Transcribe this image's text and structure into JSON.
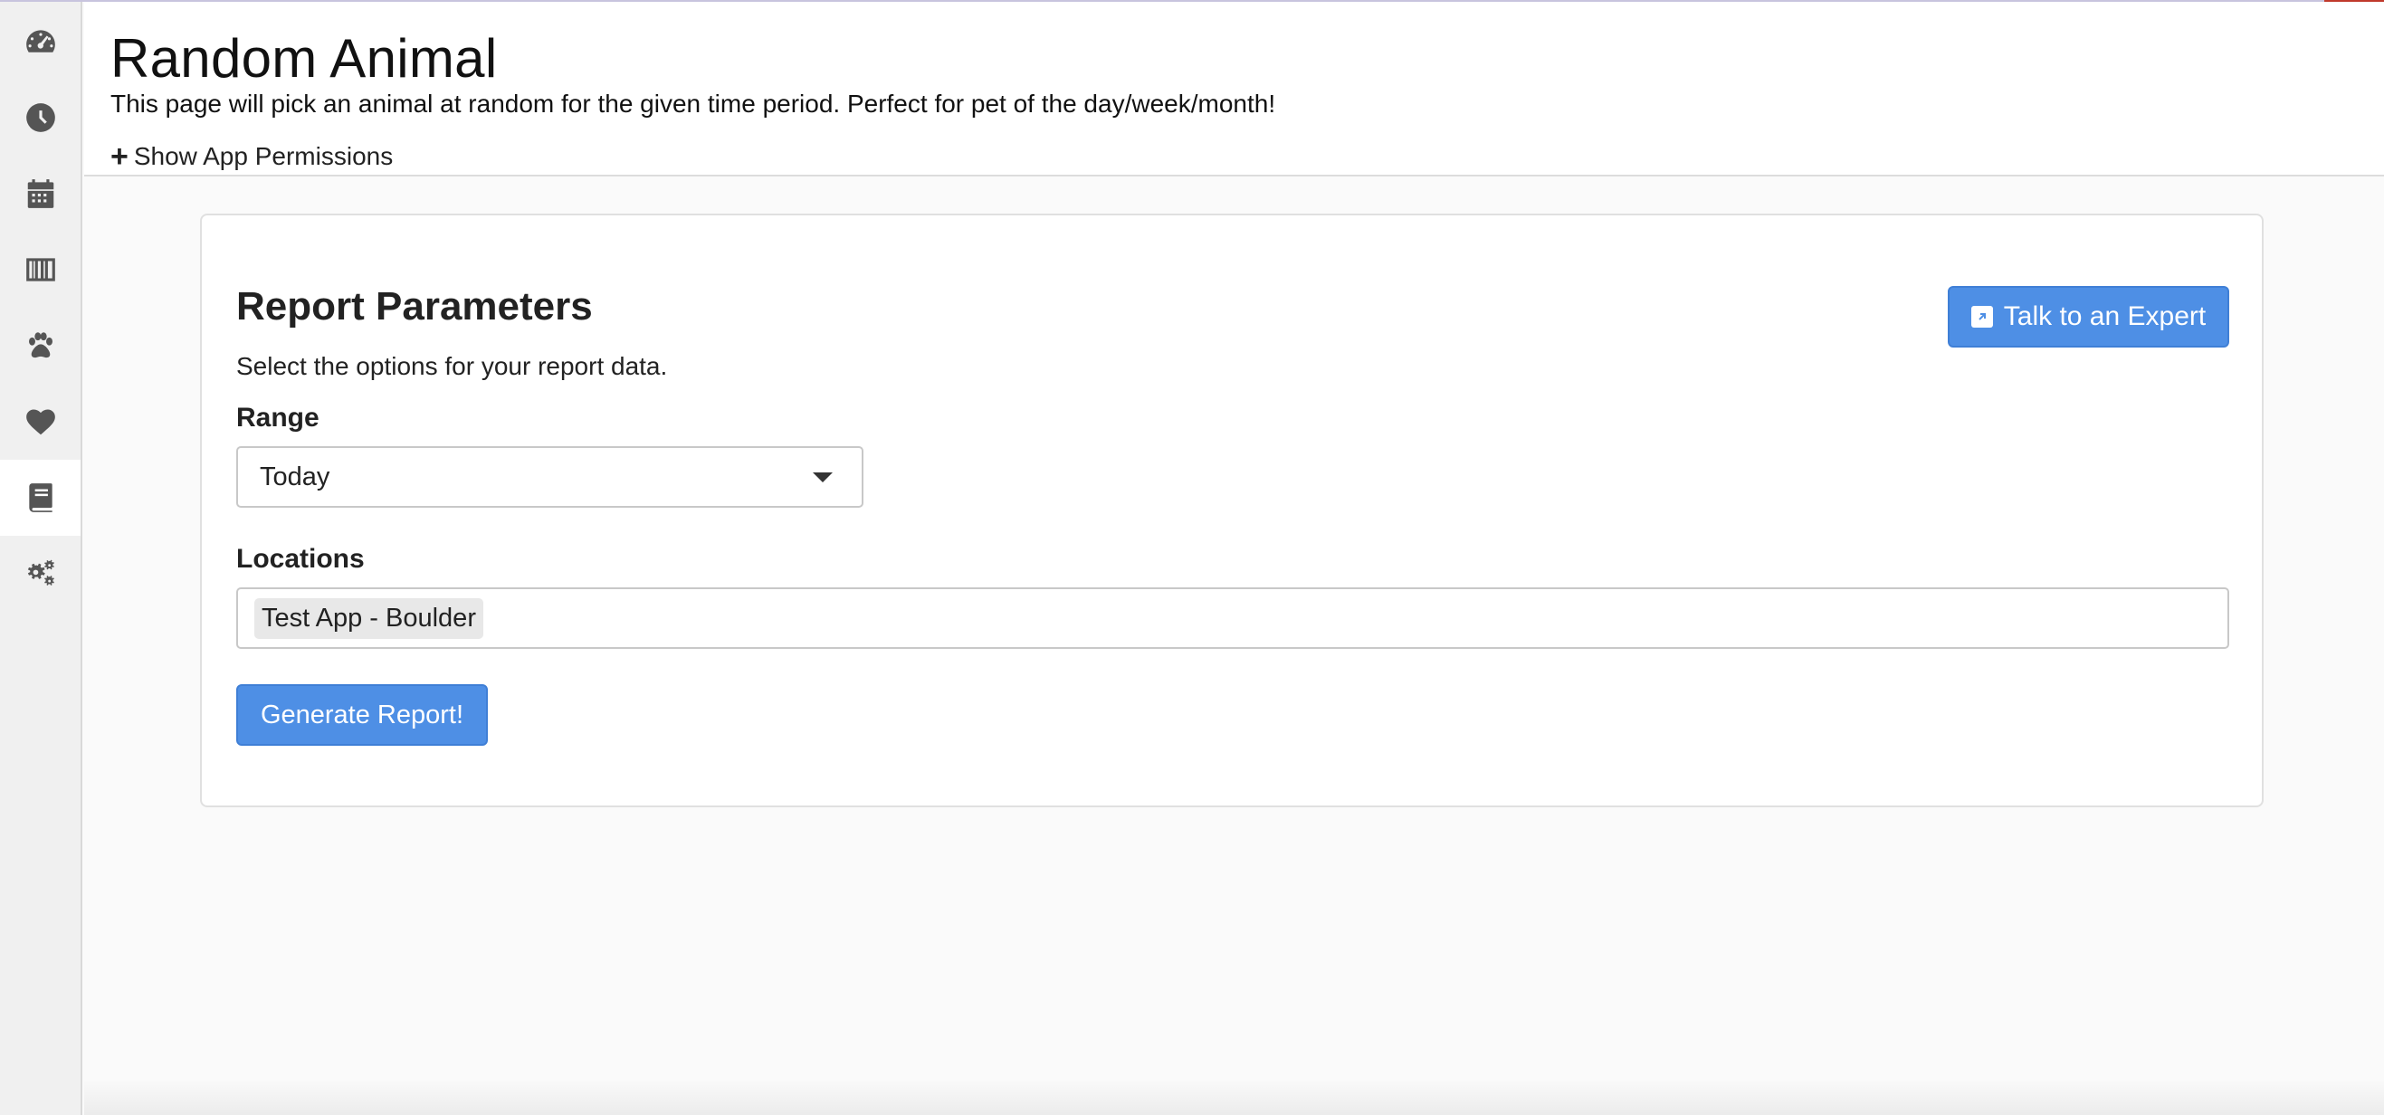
{
  "header": {
    "title": "Random Animal",
    "description": "This page will pick an animal at random for the given time period. Perfect for pet of the day/week/month!",
    "permissions_toggle": "Show App Permissions"
  },
  "sidebar": {
    "items": [
      {
        "icon": "dashboard-gauge-icon"
      },
      {
        "icon": "clock-icon"
      },
      {
        "icon": "calendar-icon"
      },
      {
        "icon": "barcode-icon"
      },
      {
        "icon": "paw-icon"
      },
      {
        "icon": "heart-icon"
      },
      {
        "icon": "book-icon",
        "active": true
      },
      {
        "icon": "settings-gears-icon"
      }
    ]
  },
  "report": {
    "title": "Report Parameters",
    "subtitle": "Select the options for your report data.",
    "expert_button": "Talk to an Expert",
    "range_label": "Range",
    "range_value": "Today",
    "locations_label": "Locations",
    "locations": [
      "Test App - Boulder"
    ],
    "generate_button": "Generate Report!"
  },
  "colors": {
    "primary_button": "#4e8fe5",
    "sidebar_bg": "#f0f0f0"
  }
}
